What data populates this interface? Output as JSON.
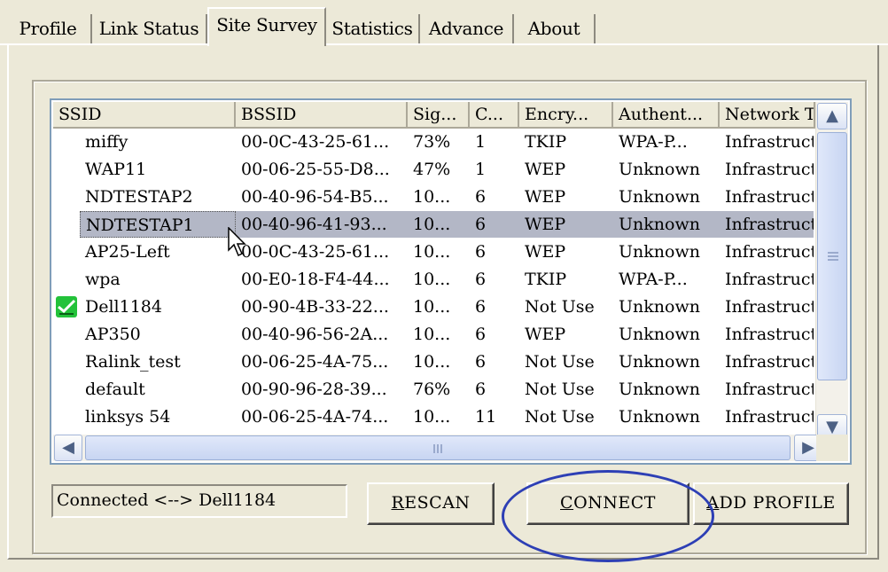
{
  "tabs": [
    {
      "label": "Profile"
    },
    {
      "label": "Link Status"
    },
    {
      "label": "Site Survey"
    },
    {
      "label": "Statistics"
    },
    {
      "label": "Advance"
    },
    {
      "label": "About"
    }
  ],
  "active_tab": "Site Survey",
  "columns": [
    "SSID",
    "BSSID",
    "Sig...",
    "C...",
    "Encry...",
    "Authent...",
    "Network T"
  ],
  "rows": [
    {
      "ssid": "miffy",
      "bssid": "00-0C-43-25-61...",
      "signal": "73%",
      "channel": "1",
      "encryption": "TKIP",
      "auth": "WPA-P...",
      "network": "Infrastruct."
    },
    {
      "ssid": "WAP11",
      "bssid": "00-06-25-55-D8...",
      "signal": "47%",
      "channel": "1",
      "encryption": "WEP",
      "auth": "Unknown",
      "network": "Infrastruct."
    },
    {
      "ssid": "NDTESTAP2",
      "bssid": "00-40-96-54-B5...",
      "signal": "10...",
      "channel": "6",
      "encryption": "WEP",
      "auth": "Unknown",
      "network": "Infrastruct."
    },
    {
      "ssid": "NDTESTAP1",
      "bssid": "00-40-96-41-93...",
      "signal": "10...",
      "channel": "6",
      "encryption": "WEP",
      "auth": "Unknown",
      "network": "Infrastruct.",
      "selected": true
    },
    {
      "ssid": "AP25-Left",
      "bssid": "00-0C-43-25-61...",
      "signal": "10...",
      "channel": "6",
      "encryption": "WEP",
      "auth": "Unknown",
      "network": "Infrastruct."
    },
    {
      "ssid": "wpa",
      "bssid": "00-E0-18-F4-44...",
      "signal": "10...",
      "channel": "6",
      "encryption": "TKIP",
      "auth": "WPA-P...",
      "network": "Infrastruct."
    },
    {
      "ssid": "Dell1184",
      "bssid": "00-90-4B-33-22...",
      "signal": "10...",
      "channel": "6",
      "encryption": "Not Use",
      "auth": "Unknown",
      "network": "Infrastruct.",
      "connected": true
    },
    {
      "ssid": "AP350",
      "bssid": "00-40-96-56-2A...",
      "signal": "10...",
      "channel": "6",
      "encryption": "WEP",
      "auth": "Unknown",
      "network": "Infrastruct."
    },
    {
      "ssid": "Ralink_test",
      "bssid": "00-06-25-4A-75...",
      "signal": "10...",
      "channel": "6",
      "encryption": "Not Use",
      "auth": "Unknown",
      "network": "Infrastruct."
    },
    {
      "ssid": "default",
      "bssid": "00-90-96-28-39...",
      "signal": "76%",
      "channel": "6",
      "encryption": "Not Use",
      "auth": "Unknown",
      "network": "Infrastruct."
    },
    {
      "ssid": "linksys 54",
      "bssid": "00-06-25-4A-74...",
      "signal": "10...",
      "channel": "11",
      "encryption": "Not Use",
      "auth": "Unknown",
      "network": "Infrastruct."
    }
  ],
  "status_text": "Connected <--> Dell1184",
  "buttons": {
    "rescan": {
      "mnemonic": "R",
      "rest": "ESCAN"
    },
    "connect": {
      "mnemonic": "C",
      "rest": "ONNECT"
    },
    "add_profile": {
      "mnemonic": "A",
      "rest": "DD PROFILE"
    }
  },
  "colors": {
    "highlight_ellipse": "#2d3fb5",
    "selected_row": "#b3b7c6",
    "connected_icon": "#23c23a"
  }
}
